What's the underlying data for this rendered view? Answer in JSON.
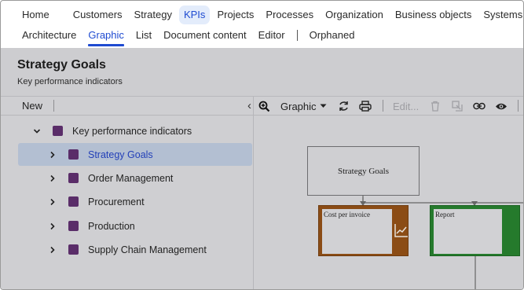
{
  "nav": {
    "row1": [
      "Home",
      "Customers",
      "Strategy",
      "KPIs",
      "Projects",
      "Processes",
      "Organization",
      "Business objects",
      "Systems"
    ],
    "row2": [
      "Architecture",
      "Graphic",
      "List",
      "Document content",
      "Editor",
      "Orphaned"
    ]
  },
  "header": {
    "title": "Strategy Goals",
    "subtitle": "Key performance indicators"
  },
  "left_panel": {
    "new_label": "New",
    "tree": [
      {
        "label": "Key performance indicators",
        "expanded": true,
        "level": 0
      },
      {
        "label": "Strategy Goals",
        "selected": true,
        "level": 1
      },
      {
        "label": "Order Management",
        "level": 1
      },
      {
        "label": "Procurement",
        "level": 1
      },
      {
        "label": "Production",
        "level": 1
      },
      {
        "label": "Supply Chain Management",
        "level": 1
      }
    ]
  },
  "toolbar": {
    "view_label": "Graphic",
    "edit_label": "Edit...",
    "icons": [
      "zoom-in-icon",
      "chevron-down-icon",
      "refresh-icon",
      "print-icon",
      "delete-icon",
      "move-icon",
      "link-icon",
      "eye-icon"
    ]
  },
  "diagram": {
    "root": "Strategy Goals",
    "children": [
      "Cost per invoice",
      "Report"
    ]
  },
  "colors": {
    "accent": "#1f4bd1",
    "folder": "#5a2d69",
    "cost_box": "#8b4c15",
    "report_box": "#257a2c"
  }
}
